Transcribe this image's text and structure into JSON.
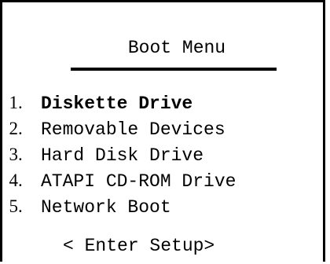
{
  "boot_menu": {
    "title": "Boot Menu",
    "items": [
      {
        "number": "1",
        "label": "Diskette Drive",
        "selected": true
      },
      {
        "number": "2",
        "label": "Removable Devices",
        "selected": false
      },
      {
        "number": "3",
        "label": "Hard Disk Drive",
        "selected": false
      },
      {
        "number": "4",
        "label": "ATAPI CD-ROM Drive",
        "selected": false
      },
      {
        "number": "5",
        "label": "Network Boot",
        "selected": false
      }
    ],
    "setup_option": "< Enter Setup>"
  }
}
